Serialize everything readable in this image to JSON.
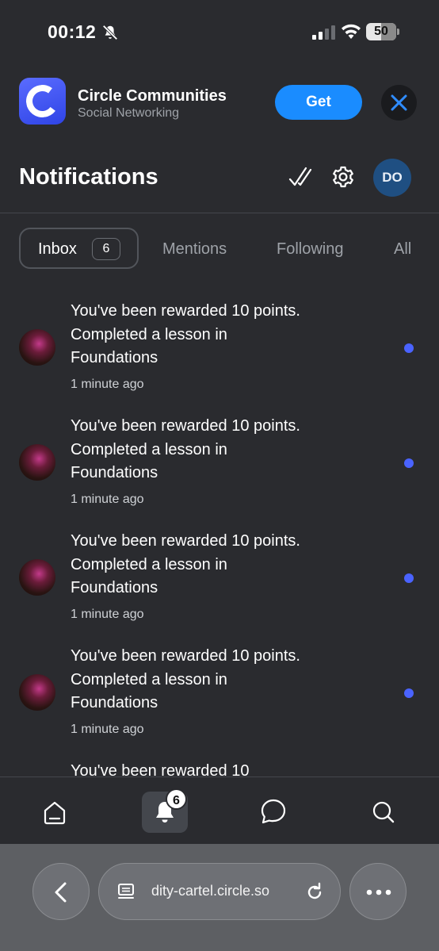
{
  "status_bar": {
    "time": "00:12",
    "battery_level": "50",
    "battery_fraction": 0.5
  },
  "app_banner": {
    "app_name": "Circle Communities",
    "category": "Social Networking",
    "get_label": "Get",
    "icon_color": "#3b52f0"
  },
  "header": {
    "title": "Notifications",
    "avatar_initials": "DO"
  },
  "tabs": [
    {
      "label": "Inbox",
      "count": "6",
      "active": true
    },
    {
      "label": "Mentions"
    },
    {
      "label": "Following"
    },
    {
      "label": "All"
    }
  ],
  "notifications": [
    {
      "text": "You've been rewarded 10 points. Completed a lesson in Foundations",
      "time": "1 minute ago",
      "unread": true
    },
    {
      "text": "You've been rewarded 10 points. Completed a lesson in Foundations",
      "time": "1 minute ago",
      "unread": true
    },
    {
      "text": "You've been rewarded 10 points. Completed a lesson in Foundations",
      "time": "1 minute ago",
      "unread": true
    },
    {
      "text": "You've been rewarded 10 points. Completed a lesson in Foundations",
      "time": "1 minute ago",
      "unread": true
    },
    {
      "text": "You've been rewarded 10",
      "time": "",
      "unread": false
    }
  ],
  "bottom_nav": {
    "items": [
      "home-icon",
      "bell-icon",
      "chat-bubble-icon",
      "search-icon"
    ],
    "notification_badge": "6"
  },
  "browser": {
    "url": "dity-cartel.circle.so"
  },
  "colors": {
    "background": "#2a2b2f",
    "accent_blue": "#1a8cff",
    "unread_dot": "#4a63ff",
    "avatar_do": "#1f4f82"
  }
}
